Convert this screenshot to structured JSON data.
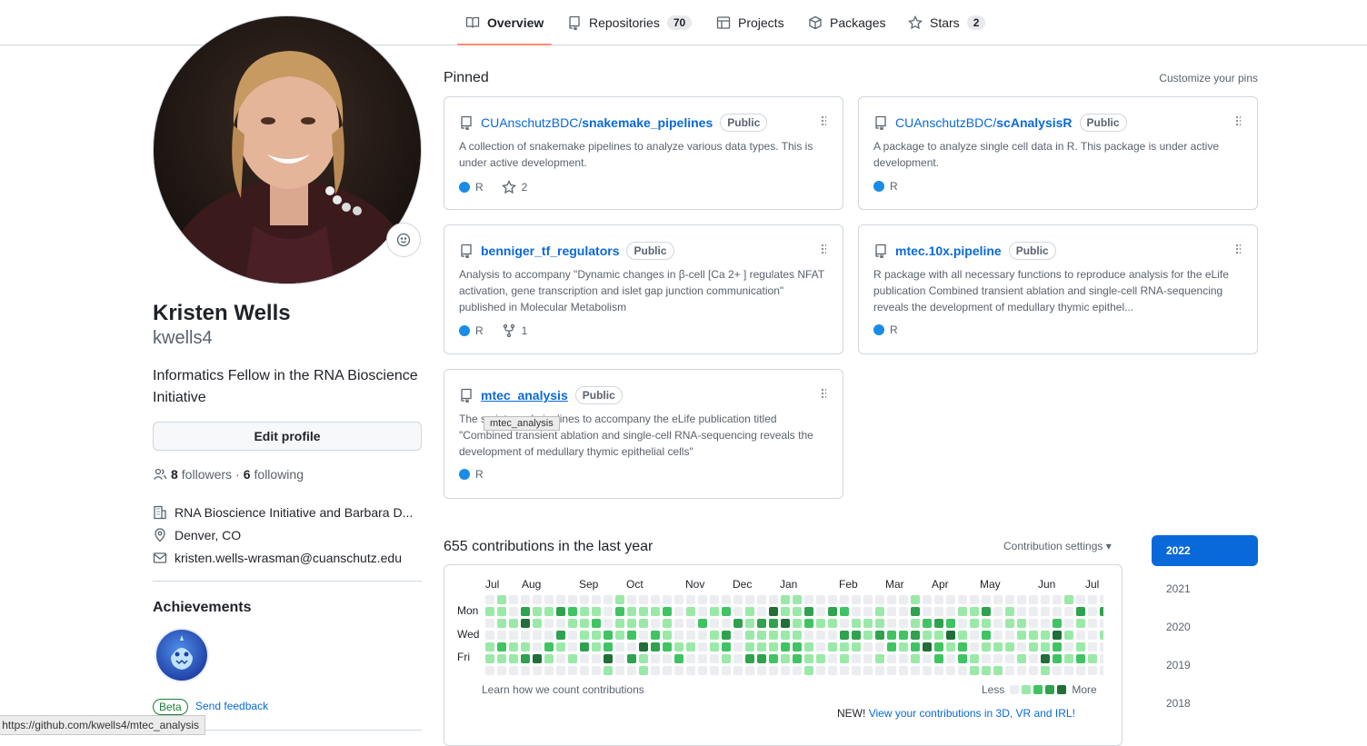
{
  "nav": {
    "tabs": [
      {
        "label": "Overview",
        "icon": "book-icon"
      },
      {
        "label": "Repositories",
        "count": "70",
        "icon": "repo-icon"
      },
      {
        "label": "Projects",
        "icon": "table-icon"
      },
      {
        "label": "Packages",
        "icon": "package-icon"
      },
      {
        "label": "Stars",
        "count": "2",
        "icon": "star-icon"
      }
    ]
  },
  "profile": {
    "name": "Kristen Wells",
    "login": "kwells4",
    "bio": "Informatics Fellow in the RNA Bioscience Initiative",
    "edit_label": "Edit profile",
    "followers_count": "8",
    "followers_label": "followers",
    "sep": "·",
    "following_count": "6",
    "following_label": "following",
    "org": "RNA Bioscience Initiative and Barbara D...",
    "location": "Denver, CO",
    "email": "kristen.wells-wrasman@cuanschutz.edu"
  },
  "achievements": {
    "title": "Achievements",
    "beta": "Beta",
    "feedback": "Send feedback"
  },
  "statusbar": "https://github.com/kwells4/mtec_analysis",
  "pinned": {
    "title": "Pinned",
    "customize": "Customize your pins",
    "cards": [
      {
        "owner": "CUAnschutzBDC/",
        "name": "snakemake_pipelines",
        "badge": "Public",
        "desc": "A collection of snakemake pipelines to analyze various data types. This is under active development.",
        "lang": "R",
        "stars": "2"
      },
      {
        "owner": "CUAnschutzBDC/",
        "name": "scAnalysisR",
        "badge": "Public",
        "desc": "A package to analyze single cell data in R. This package is under active development.",
        "lang": "R"
      },
      {
        "owner": "",
        "name": "benniger_tf_regulators",
        "badge": "Public",
        "desc": "Analysis to accompany \"Dynamic changes in β-cell [Ca 2+ ] regulates NFAT activation, gene transcription and islet gap junction communication\" published in Molecular Metabolism",
        "lang": "R",
        "forks": "1"
      },
      {
        "owner": "",
        "name": "mtec.10x.pipeline",
        "badge": "Public",
        "desc": "R package with all necessary functions to reproduce analysis for the eLife publication Combined transient ablation and single-cell RNA-sequencing reveals the development of medullary thymic epithel...",
        "lang": "R"
      },
      {
        "owner": "",
        "name": "mtec_analysis",
        "badge": "Public",
        "desc": "The scripts and pipelines to accompany the eLife publication titled \"Combined transient ablation and single-cell RNA-sequencing reveals the development of medullary thymic epithelial cells\"",
        "lang": "R"
      }
    ],
    "tooltip": "mtec_analysis"
  },
  "contributions": {
    "title": "655 contributions in the last year",
    "settings": "Contribution settings ▾",
    "months": [
      "Jul",
      "Aug",
      "Sep",
      "Oct",
      "Nov",
      "Dec",
      "Jan",
      "Feb",
      "Mar",
      "Apr",
      "May",
      "Jun",
      "Jul"
    ],
    "days": [
      "Mon",
      "Wed",
      "Fri"
    ],
    "learn": "Learn how we count contributions",
    "less": "Less",
    "more": "More",
    "new_prefix": "NEW!",
    "new_link": "View your contributions in 3D, VR and IRL!",
    "colors": [
      "#ebedf0",
      "#9be9a8",
      "#40c463",
      "#30a14e",
      "#216e39"
    ]
  },
  "years": [
    "2022",
    "2021",
    "2020",
    "2019",
    "2018"
  ]
}
